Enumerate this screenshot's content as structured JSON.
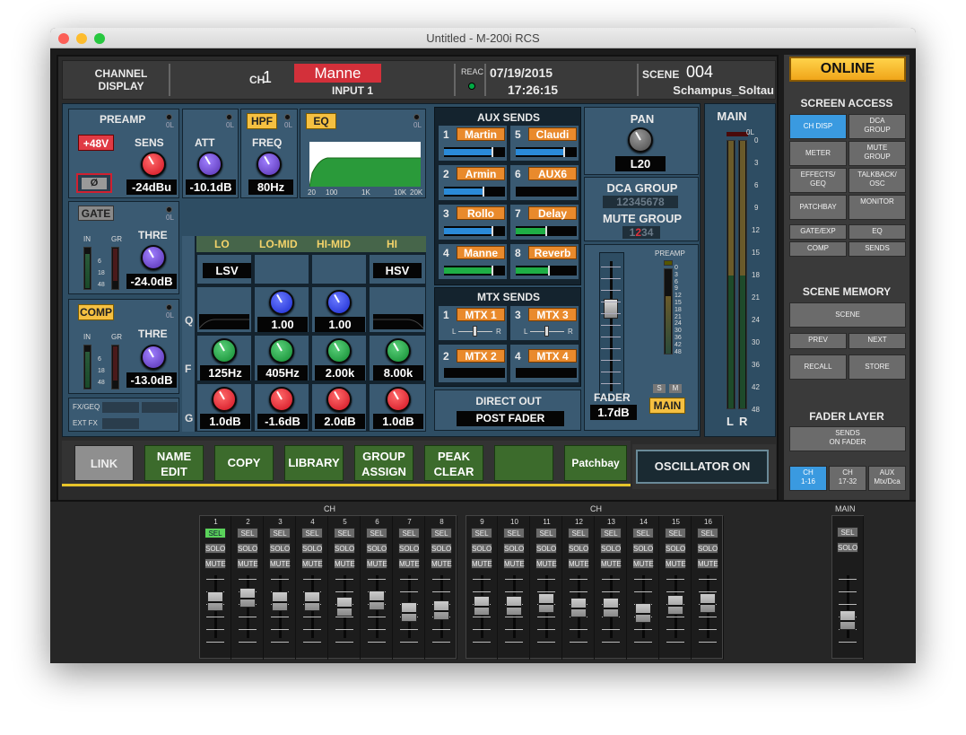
{
  "window": {
    "title": "Untitled - M-200i RCS"
  },
  "header": {
    "channel_display": "CHANNEL\nDISPLAY",
    "ch_label": "CH",
    "ch_number": "1",
    "ch_name": "Manne",
    "input": "INPUT 1",
    "reac": "REAC",
    "date": "07/19/2015",
    "time": "17:26:15",
    "scene_label": "SCENE",
    "scene_number": "004",
    "scene_name": "Schampus_Soltau"
  },
  "preamp": {
    "title": "PREAMP",
    "phantom": "+48V",
    "sens_label": "SENS",
    "sens_value": "-24dBu",
    "phase": "Ø",
    "att_label": "ATT",
    "att_value": "-10.1dB",
    "hpf": "HPF",
    "freq_label": "FREQ",
    "freq_value": "80Hz",
    "eq": "EQ",
    "ol": "0L"
  },
  "eq_graph": {
    "x_labels": [
      "20",
      "100",
      "1K",
      "10K",
      "20K"
    ]
  },
  "gate": {
    "title": "GATE",
    "in": "IN",
    "gr": "GR",
    "thre_label": "THRE",
    "thre_value": "-24.0dB",
    "scale": [
      "6",
      "18",
      "48"
    ]
  },
  "comp": {
    "title": "COMP",
    "in": "IN",
    "gr": "GR",
    "thre_label": "THRE",
    "thre_value": "-13.0dB",
    "scale": [
      "6",
      "18",
      "48"
    ]
  },
  "fx": {
    "fx_geq": "FX/GEQ",
    "ext_fx": "EXT FX"
  },
  "eq_bands": {
    "headers": [
      "LO",
      "LO-MID",
      "HI-MID",
      "HI"
    ],
    "row_labels": [
      "Q",
      "F",
      "G"
    ],
    "types": [
      "LSV",
      "",
      "",
      "HSV"
    ],
    "q": [
      "",
      "1.00",
      "1.00",
      ""
    ],
    "f": [
      "125Hz",
      "405Hz",
      "2.00k",
      "8.00k"
    ],
    "g": [
      "1.0dB",
      "-1.6dB",
      "2.0dB",
      "1.0dB"
    ]
  },
  "aux_sends": {
    "title": "AUX SENDS",
    "items": [
      {
        "num": "1",
        "name": "Martin",
        "level": 0.8
      },
      {
        "num": "5",
        "name": "Claudi",
        "level": 0.8
      },
      {
        "num": "2",
        "name": "Armin",
        "level": 0.65
      },
      {
        "num": "6",
        "name": "AUX6",
        "level": 0.0
      },
      {
        "num": "3",
        "name": "Rollo",
        "level": 0.8
      },
      {
        "num": "7",
        "name": "Delay",
        "level": 0.5
      },
      {
        "num": "4",
        "name": "Manne",
        "level": 0.8
      },
      {
        "num": "8",
        "name": "Reverb",
        "level": 0.55
      }
    ]
  },
  "mtx_sends": {
    "title": "MTX SENDS",
    "items": [
      {
        "num": "1",
        "name": "MTX 1"
      },
      {
        "num": "3",
        "name": "MTX 3"
      },
      {
        "num": "2",
        "name": "MTX 2"
      },
      {
        "num": "4",
        "name": "MTX 4"
      }
    ],
    "l": "L",
    "r": "R"
  },
  "direct_out": {
    "title": "DIRECT OUT",
    "value": "POST FADER"
  },
  "pan": {
    "label": "PAN",
    "value": "L20"
  },
  "dca": {
    "label": "DCA GROUP",
    "digits": "12345678",
    "mute_label": "MUTE GROUP",
    "mute_digits": [
      "1",
      "2",
      "3",
      "4"
    ]
  },
  "fader": {
    "label": "FADER",
    "value": "1.7dB",
    "preamp": "PREAMP",
    "scale": [
      "0",
      "3",
      "6",
      "9",
      "12",
      "15",
      "18",
      "21",
      "24",
      "30",
      "36",
      "42",
      "48"
    ],
    "s": "S",
    "m": "M",
    "main": "MAIN",
    "level": 0.68
  },
  "main_meter": {
    "title": "MAIN",
    "ol": "0L",
    "scale": [
      "0",
      "3",
      "6",
      "9",
      "12",
      "15",
      "18",
      "21",
      "24",
      "30",
      "36",
      "42",
      "48"
    ],
    "l": "L",
    "r": "R"
  },
  "bottom_buttons": {
    "link": "LINK",
    "name_edit": "NAME\nEDIT",
    "copy": "COPY",
    "library": "LIBRARY",
    "group_assign": "GROUP\nASSIGN",
    "peak_clear": "PEAK\nCLEAR",
    "blank": "",
    "patchbay": "Patchbay",
    "oscillator": "OSCILLATOR ON"
  },
  "right": {
    "online": "ONLINE",
    "screen_access": "SCREEN ACCESS",
    "sa_buttons": [
      "CH DISP",
      "DCA\nGROUP",
      "METER",
      "MUTE\nGROUP",
      "EFFECTS/\nGEQ",
      "TALKBACK/\nOSC",
      "PATCHBAY",
      "MONITOR"
    ],
    "sa_buttons2": [
      "GATE/EXP",
      "EQ",
      "COMP",
      "SENDS"
    ],
    "scene_memory": "SCENE MEMORY",
    "scene": "SCENE",
    "prev": "PREV",
    "next": "NEXT",
    "recall": "RECALL",
    "store": "STORE",
    "fader_layer": "FADER LAYER",
    "sends_on_fader": "SENDS\nON FADER",
    "layers": [
      "CH\n1-16",
      "CH\n17-32",
      "AUX\nMtx/Dca"
    ]
  },
  "faders": {
    "ch_label": "CH",
    "main_label": "MAIN",
    "sel": "SEL",
    "solo": "SOLO",
    "mute": "MUTE",
    "channels": [
      {
        "n": "1",
        "level": 0.7
      },
      {
        "n": "2",
        "level": 0.76
      },
      {
        "n": "3",
        "level": 0.7
      },
      {
        "n": "4",
        "level": 0.7
      },
      {
        "n": "5",
        "level": 0.6
      },
      {
        "n": "6",
        "level": 0.72
      },
      {
        "n": "7",
        "level": 0.5
      },
      {
        "n": "8",
        "level": 0.53
      },
      {
        "n": "9",
        "level": 0.62
      },
      {
        "n": "10",
        "level": 0.62
      },
      {
        "n": "11",
        "level": 0.66
      },
      {
        "n": "12",
        "level": 0.58
      },
      {
        "n": "13",
        "level": 0.58
      },
      {
        "n": "14",
        "level": 0.48
      },
      {
        "n": "15",
        "level": 0.64
      },
      {
        "n": "16",
        "level": 0.67
      }
    ],
    "main_level": 0.35
  }
}
